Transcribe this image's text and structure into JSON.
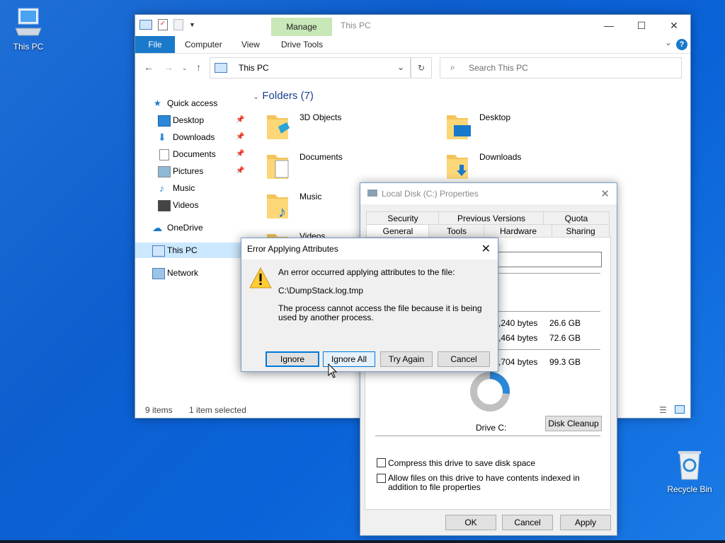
{
  "desktop": {
    "this_pc_label": "This PC",
    "recycle_bin_label": "Recycle Bin"
  },
  "explorer": {
    "title": "This PC",
    "manage_tab": "Manage",
    "ribbon_tabs": [
      "File",
      "Computer",
      "View",
      "Drive Tools"
    ],
    "address": "This PC",
    "search_placeholder": "Search This PC",
    "nav": {
      "quick_access": "Quick access",
      "desktop": "Desktop",
      "downloads": "Downloads",
      "documents": "Documents",
      "pictures": "Pictures",
      "music": "Music",
      "videos": "Videos",
      "onedrive": "OneDrive",
      "this_pc": "This PC",
      "network": "Network"
    },
    "folders_header": "Folders (7)",
    "folders": [
      "3D Objects",
      "Desktop",
      "Documents",
      "Downloads",
      "Music",
      "Videos"
    ],
    "status_items": "9 items",
    "status_selected": "1 item selected",
    "colors": {
      "accent": "#1979ca",
      "selected": "#cce8ff",
      "manage_bg": "#c8e8b8"
    }
  },
  "props": {
    "title": "Local Disk (C:) Properties",
    "tabs_row1": [
      "Security",
      "Previous Versions",
      "Quota"
    ],
    "tabs_row2": [
      "General",
      "Tools",
      "Hardware",
      "Sharing"
    ],
    "used_bytes": ",240 bytes",
    "used_gb": "26.6 GB",
    "free_bytes": ",464 bytes",
    "free_gb": "72.6 GB",
    "cap_bytes": ",704 bytes",
    "cap_gb": "99.3 GB",
    "drive_label": "Drive C:",
    "disk_cleanup": "Disk Cleanup",
    "compress_label": "Compress this drive to save disk space",
    "index_label": "Allow files on this drive to have contents indexed in addition to file properties",
    "ok": "OK",
    "cancel": "Cancel",
    "apply": "Apply",
    "used_fraction": 0.268
  },
  "error_dialog": {
    "title": "Error Applying Attributes",
    "line1": "An error occurred applying attributes to the file:",
    "path": "C:\\DumpStack.log.tmp",
    "line2": "The process cannot access the file because it is being used by another process.",
    "ignore": "Ignore",
    "ignore_all": "Ignore All",
    "try_again": "Try Again",
    "cancel": "Cancel"
  }
}
